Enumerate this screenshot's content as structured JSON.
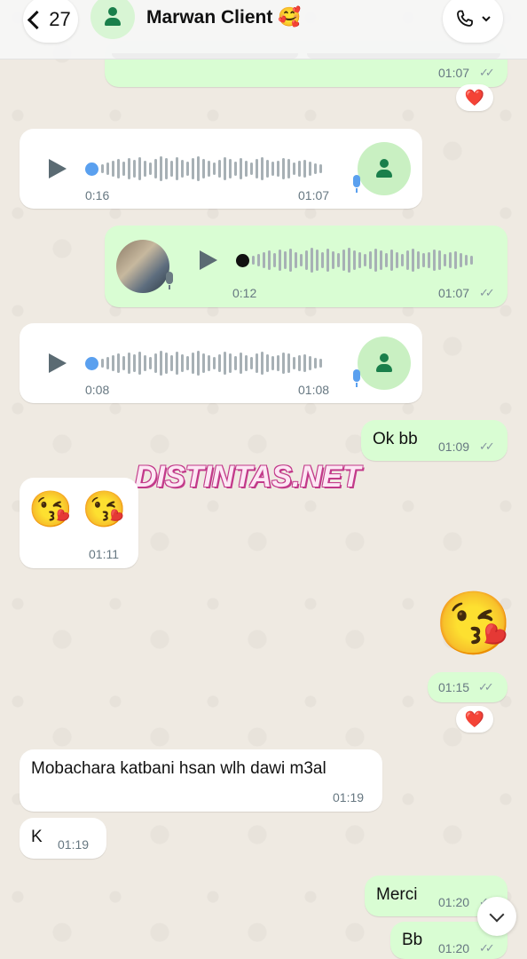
{
  "header": {
    "back_count": "27",
    "contact_name": "Marwan Client 🥰"
  },
  "messages": {
    "m0": {
      "time": "01:07",
      "ticks": "✓✓",
      "reaction": "❤️"
    },
    "m1": {
      "duration": "0:16",
      "time": "01:07"
    },
    "m2": {
      "duration": "0:12",
      "time": "01:07",
      "ticks": "✓✓"
    },
    "m3": {
      "duration": "0:08",
      "time": "01:08"
    },
    "m4": {
      "text": "Ok bb",
      "time": "01:09",
      "ticks": "✓✓"
    },
    "m5": {
      "emoji": "😘 😘",
      "time": "01:11"
    },
    "m6": {
      "emoji": "😘",
      "time": "01:15",
      "ticks": "✓✓",
      "reaction": "❤️"
    },
    "m7": {
      "text": "Mobachara katbani hsan wlh dawi m3al",
      "time": "01:19"
    },
    "m8": {
      "text": "K",
      "time": "01:19"
    },
    "m9": {
      "text": "Merci",
      "time": "01:20",
      "ticks": "✓✓"
    },
    "m10": {
      "text": "Bb",
      "time": "01:20",
      "ticks": "✓✓"
    }
  },
  "watermark": "DISTINTAS.NET",
  "colors": {
    "background": "#efeae2",
    "outgoing_bubble": "#d9fdd3",
    "incoming_bubble": "#ffffff",
    "voice_progress_dot": "#5aa0ef",
    "mic_icon": "#5aa0ef"
  }
}
